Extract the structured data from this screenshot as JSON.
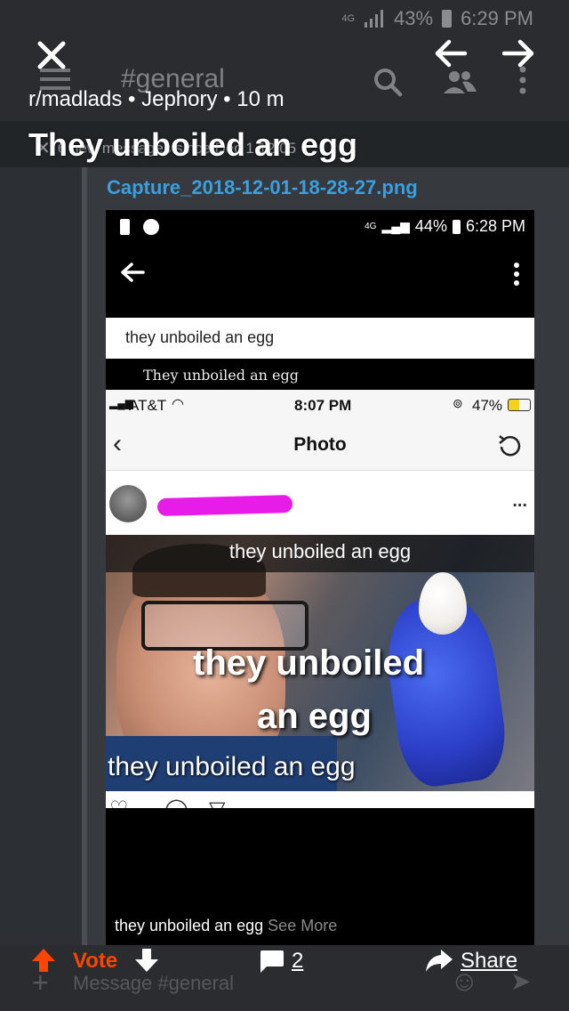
{
  "status": {
    "network": "4G",
    "battery": "43%",
    "time": "6:29 PM"
  },
  "topbar": {
    "channel": "#general",
    "subtitle": "r/madlads • Jephory • 10 m",
    "icons": [
      "close-icon",
      "back-arrow-icon",
      "forward-arrow-icon",
      "menu-icon",
      "search-icon",
      "members-icon",
      "more-vertical-icon"
    ]
  },
  "post": {
    "title": "They unboiled an egg",
    "overlay_text": "6 new messages since Dec 1 12:05",
    "filename": "Capture_2018-12-01-18-28-27.png"
  },
  "screenshot": {
    "status": {
      "network": "4G",
      "battery": "44%",
      "time": "6:28 PM"
    },
    "search_value": "they unboiled an egg",
    "serif_title": "They unboiled an egg",
    "iphone": {
      "carrier": "AT&T",
      "time": "8:07 PM",
      "battery": "47%",
      "nav_title": "Photo",
      "more": "..."
    },
    "meme": {
      "top_caption": "they unboiled an egg",
      "big_line1": "they unboiled",
      "big_line2": "an egg",
      "bottom_caption": "they unboiled an egg"
    },
    "caption": "they unboiled an egg",
    "see_more": "See More"
  },
  "bottombar": {
    "vote": "Vote",
    "comments": "2",
    "share": "Share",
    "message_placeholder": "Message #general"
  },
  "colors": {
    "accent_orange": "#ff4500",
    "link_blue": "#3a9fdc",
    "redaction_magenta": "#e81ce8"
  }
}
